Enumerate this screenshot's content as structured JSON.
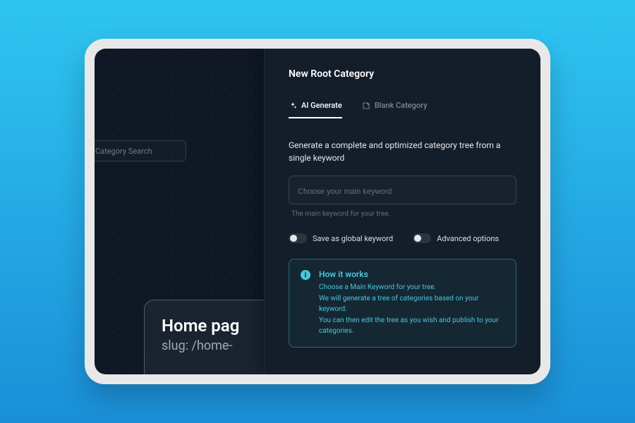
{
  "search": {
    "placeholder": "Category Search"
  },
  "preview": {
    "title": "Home pag",
    "slug": "slug: /home-"
  },
  "panel": {
    "title": "New Root Category",
    "tabs": [
      {
        "label": "AI Generate",
        "active": true
      },
      {
        "label": "Blank Category",
        "active": false
      }
    ],
    "description": "Generate a complete and optimized category tree from a single keyword",
    "keyword_input": {
      "placeholder": "Choose your main keyword",
      "helper": "The main keyword for your tree."
    },
    "toggles": {
      "save_global": {
        "label": "Save as global keyword",
        "value": false
      },
      "advanced": {
        "label": "Advanced options",
        "value": false
      }
    },
    "callout": {
      "title": "How it works",
      "lines": [
        "Choose a Main Keyword for your tree.",
        "We will generate a tree of categories based on your keyword.",
        "You can then edit the tree as you wish and publish to your categories."
      ]
    }
  }
}
